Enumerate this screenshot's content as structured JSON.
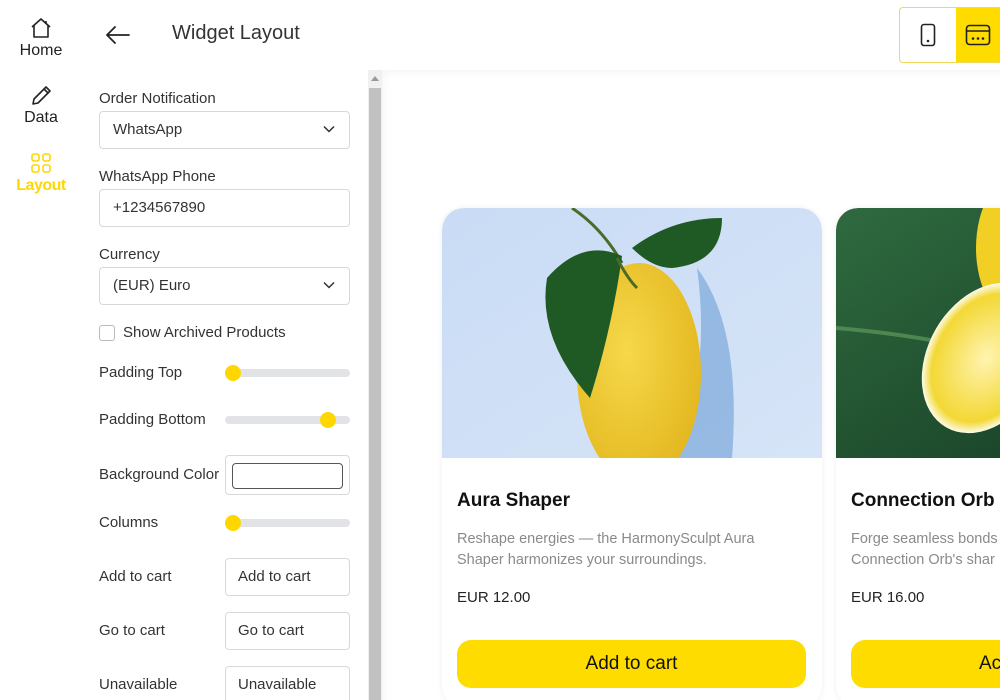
{
  "nav": {
    "items": [
      {
        "label": "Home",
        "icon": "home-icon",
        "active": false
      },
      {
        "label": "Data",
        "icon": "pencil-icon",
        "active": false
      },
      {
        "label": "Layout",
        "icon": "grid-icon",
        "active": true
      }
    ]
  },
  "header": {
    "title": "Widget Layout",
    "back_icon": "arrow-left-icon",
    "view_toggle": [
      {
        "name": "mobile",
        "icon": "mobile-icon",
        "active": false
      },
      {
        "name": "desktop",
        "icon": "browser-window-icon",
        "active": true
      }
    ]
  },
  "settings": {
    "order_notification": {
      "label": "Order Notification",
      "value": "WhatsApp"
    },
    "whatsapp_phone": {
      "label": "WhatsApp Phone",
      "value": "+1234567890"
    },
    "currency": {
      "label": "Currency",
      "value": "(EUR) Euro"
    },
    "show_archived": {
      "label": "Show Archived Products",
      "checked": false
    },
    "padding_top": {
      "label": "Padding Top",
      "value_fraction": 0.0
    },
    "padding_bottom": {
      "label": "Padding Bottom",
      "value_fraction": 0.87
    },
    "background_color": {
      "label": "Background Color",
      "value": "#ffffff"
    },
    "columns": {
      "label": "Columns",
      "value_fraction": 0.0
    },
    "add_to_cart": {
      "label": "Add to cart",
      "value": "Add to cart"
    },
    "go_to_cart": {
      "label": "Go to cart",
      "value": "Go to cart"
    },
    "unavailable": {
      "label": "Unavailable",
      "value": "Unavailable"
    }
  },
  "colors": {
    "accent": "#ffdc00",
    "slider_track": "#e1e3e6"
  },
  "preview": {
    "products": [
      {
        "title": "Aura Shaper",
        "description_line1": "Reshape energies — the HarmonySculpt Aura",
        "description_line2": "Shaper harmonizes your surroundings.",
        "price": "EUR 12.00",
        "button": "Add to cart",
        "image": "lemon-with-leaves-photo"
      },
      {
        "title": "Connection Orb",
        "description_line1": "Forge seamless bonds",
        "description_line2": "Connection Orb's shar",
        "price": "EUR 16.00",
        "button": "Ac",
        "image": "halved-lemon-photo"
      }
    ]
  }
}
